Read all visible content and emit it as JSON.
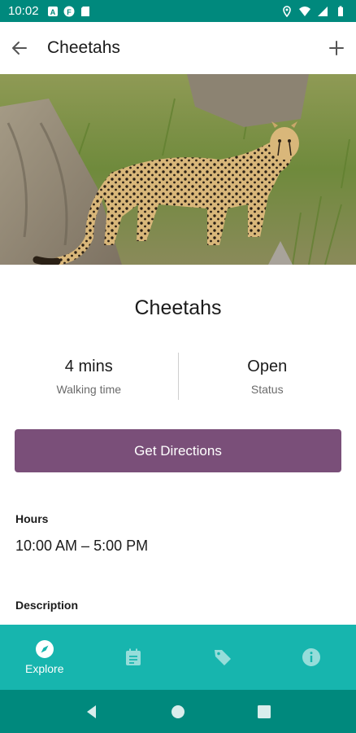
{
  "status_bar": {
    "time": "10:02",
    "left_icons": [
      "notification-a-icon",
      "notification-f-icon",
      "sd-card-icon"
    ],
    "right_icons": [
      "location-icon",
      "wifi-icon",
      "signal-icon",
      "battery-icon"
    ],
    "color": "#00897d"
  },
  "app_bar": {
    "title": "Cheetahs",
    "back_icon": "arrow-left-icon",
    "action_icon": "plus-icon"
  },
  "hero": {
    "image": "cheetah-photo"
  },
  "exhibit": {
    "name": "Cheetahs",
    "walking_time": {
      "value": "4 mins",
      "label": "Walking time"
    },
    "status": {
      "value": "Open",
      "label": "Status"
    }
  },
  "directions_button": {
    "label": "Get Directions",
    "color": "#7a4f79"
  },
  "hours": {
    "label": "Hours",
    "value": "10:00 AM – 5:00 PM"
  },
  "description": {
    "label": "Description"
  },
  "bottom_nav": {
    "color": "#17b5ae",
    "items": [
      {
        "icon": "compass-icon",
        "label": "Explore",
        "active": true
      },
      {
        "icon": "schedule-icon",
        "label": "",
        "active": false
      },
      {
        "icon": "tag-icon",
        "label": "",
        "active": false
      },
      {
        "icon": "info-icon",
        "label": "",
        "active": false
      }
    ]
  },
  "system_nav": {
    "buttons": [
      "back-triangle-icon",
      "home-circle-icon",
      "recents-square-icon"
    ]
  }
}
